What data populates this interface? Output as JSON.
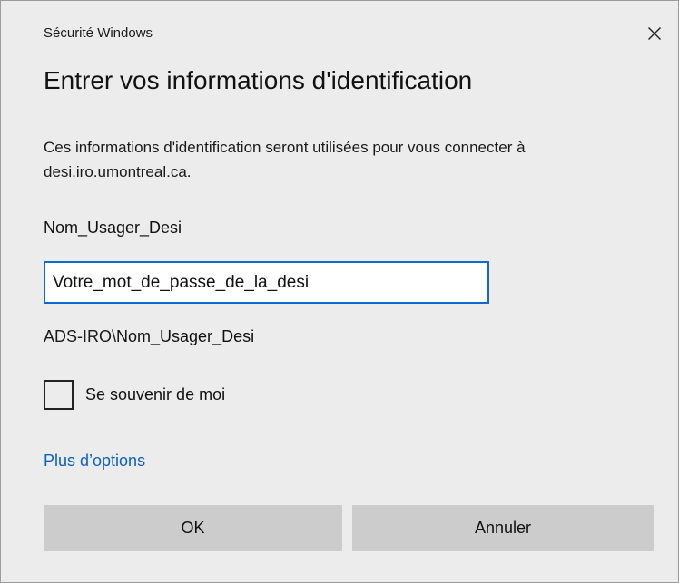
{
  "window": {
    "title": "Sécurité Windows",
    "close_icon": "close-icon"
  },
  "dialog": {
    "heading": "Entrer vos informations d'identification",
    "message": "Ces informations d'identification seront utilisées pour vous connecter à desi.iro.umontreal.ca.",
    "username": "Nom_Usager_Desi",
    "password_value": "Votre_mot_de_passe_de_la_desi",
    "domain_prefix": "ADS-IRO\\",
    "domain_user": "Nom_Usager_Desi",
    "remember_label": "Se souvenir de moi",
    "remember_checked": false,
    "more_options": "Plus d’options"
  },
  "buttons": {
    "ok": "OK",
    "cancel": "Annuler"
  },
  "colors": {
    "background": "#ececec",
    "accent": "#0b6bd3",
    "link": "#0a62c4",
    "button": "#cccccc"
  }
}
